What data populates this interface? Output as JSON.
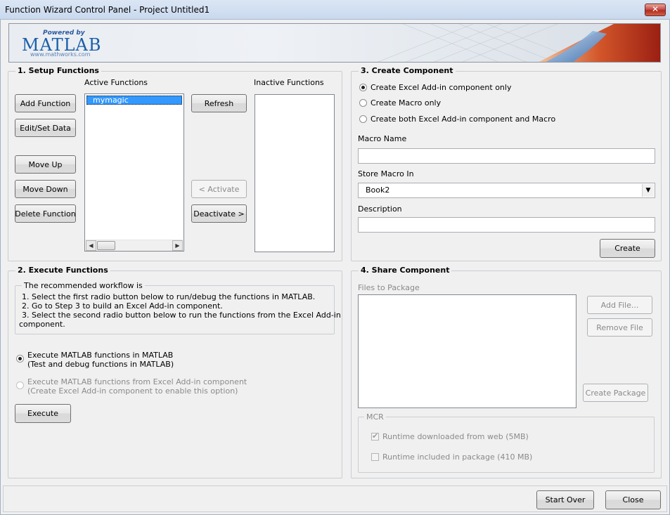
{
  "window": {
    "title": "Function Wizard Control Panel - Project Untitled1",
    "close_glyph": "✕"
  },
  "banner": {
    "powered_by": "Powered by",
    "brand": "MATLAB",
    "url": "www.mathworks.com"
  },
  "setup": {
    "title": "1. Setup Functions",
    "active_label": "Active Functions",
    "inactive_label": "Inactive Functions",
    "active_items": [
      "mymagic"
    ],
    "buttons": {
      "add": "Add Function",
      "edit": "Edit/Set Data",
      "move_up": "Move Up",
      "move_down": "Move Down",
      "delete": "Delete Function",
      "refresh": "Refresh",
      "activate": "< Activate",
      "deactivate": "Deactivate >"
    }
  },
  "create": {
    "title": "3. Create Component",
    "options": [
      "Create Excel Add-in component only",
      "Create Macro only",
      "Create both Excel Add-in component and Macro"
    ],
    "selected_index": 0,
    "macro_name_label": "Macro Name",
    "macro_name_value": "",
    "store_label": "Store Macro In",
    "store_value": "Book2",
    "description_label": "Description",
    "description_value": "",
    "create_button": "Create"
  },
  "execute": {
    "title": "2. Execute Functions",
    "workflow_title": "The recommended workflow is",
    "workflow_lines": [
      "1. Select the first radio button below to run/debug the functions in MATLAB.",
      "2. Go to Step 3 to build an Excel Add-in component.",
      "3. Select the second radio button below to run the functions from the Excel Add-in",
      "component."
    ],
    "option1_line1": "Execute MATLAB functions in MATLAB",
    "option1_line2": "(Test and debug functions in MATLAB)",
    "option2_line1": "Execute MATLAB functions from Excel Add-in component",
    "option2_line2": "(Create Excel Add-in component to enable this option)",
    "execute_button": "Execute"
  },
  "share": {
    "title": "4. Share Component",
    "files_label": "Files to Package",
    "add_file": "Add File...",
    "remove_file": "Remove File",
    "create_package": "Create Package",
    "mcr_title": "MCR",
    "mcr_web": "Runtime downloaded from web (5MB)",
    "mcr_included": "Runtime included in package (410 MB)",
    "mcr_web_checked": true,
    "mcr_included_checked": false
  },
  "footer": {
    "start_over": "Start Over",
    "close": "Close"
  }
}
